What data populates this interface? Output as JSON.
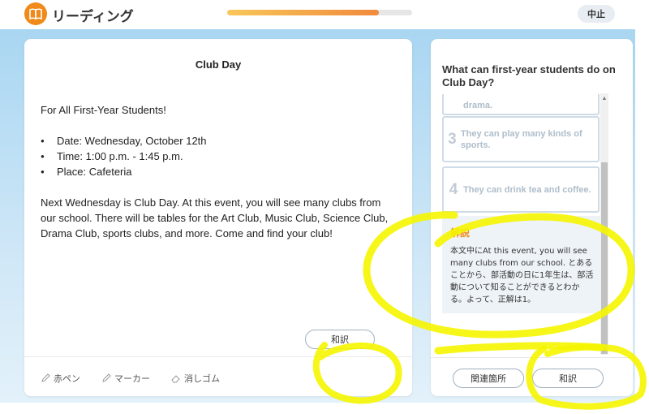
{
  "header": {
    "app_title": "リーディング",
    "logo_icon": "open-book-icon",
    "progress": 0.82,
    "quit_label": "中止"
  },
  "passage": {
    "title": "Club Day",
    "greeting": "For All First-Year Students!",
    "bullets": [
      "Date: Wednesday, October 12th",
      "Time: 1:00 p.m. - 1:45 p.m.",
      "Place: Cafeteria"
    ],
    "body": "Next Wednesday is Club Day. At this event, you will see many clubs from our school. There will be tables for the Art Club, Music Club, Science Club, Drama Club, sports clubs, and more. Come and find your club!",
    "tools": [
      {
        "label": "赤ペン",
        "icon": "pencil-icon"
      },
      {
        "label": "マーカー",
        "icon": "marker-icon"
      },
      {
        "label": "消しゴム",
        "icon": "eraser-icon"
      }
    ],
    "translate_label": "和訳"
  },
  "question": {
    "title": "What can first-year students do on Club Day?",
    "choices": [
      {
        "number": "",
        "text": "drama."
      },
      {
        "number": "3",
        "text": "They can play many kinds of sports."
      },
      {
        "number": "4",
        "text": "They can drink tea and coffee."
      }
    ],
    "explanation_title": "解説",
    "explanation_body": "本文中にAt this event, you will see many clubs from our school. とあることから、部活動の日に1年生は、部活動について知ることができるとわかる。よって、正解は1。",
    "related_label": "関連箇所",
    "translate_label": "和訳"
  },
  "colors": {
    "accent": "#f08a1a",
    "highlight_marker": "#f5f500"
  }
}
